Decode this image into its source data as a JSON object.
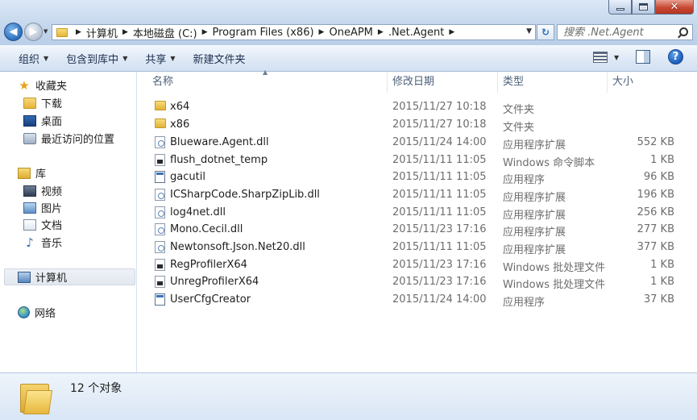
{
  "search": {
    "placeholder": "搜索 .Net.Agent"
  },
  "breadcrumbs": [
    "计算机",
    "本地磁盘 (C:)",
    "Program Files (x86)",
    "OneAPM",
    ".Net.Agent"
  ],
  "toolbar": {
    "organize": "组织",
    "include_in_library": "包含到库中",
    "share": "共享",
    "new_folder": "新建文件夹"
  },
  "nav": {
    "favorites": "收藏夹",
    "downloads": "下载",
    "desktop": "桌面",
    "recent": "最近访问的位置",
    "libraries": "库",
    "videos": "视频",
    "pictures": "图片",
    "documents": "文档",
    "music": "音乐",
    "computer": "计算机",
    "network": "网络"
  },
  "columns": {
    "name": "名称",
    "modified": "修改日期",
    "type": "类型",
    "size": "大小"
  },
  "files": [
    {
      "name": "x64",
      "date": "2015/11/27 10:18",
      "type": "文件夹",
      "size": "",
      "icon": "folder-icon"
    },
    {
      "name": "x86",
      "date": "2015/11/27 10:18",
      "type": "文件夹",
      "size": "",
      "icon": "folder-icon"
    },
    {
      "name": "Blueware.Agent.dll",
      "date": "2015/11/24 14:00",
      "type": "应用程序扩展",
      "size": "552 KB",
      "icon": "dll-icon"
    },
    {
      "name": "flush_dotnet_temp",
      "date": "2015/11/11 11:05",
      "type": "Windows 命令脚本",
      "size": "1 KB",
      "icon": "cmd-script-icon"
    },
    {
      "name": "gacutil",
      "date": "2015/11/11 11:05",
      "type": "应用程序",
      "size": "96 KB",
      "icon": "exe-icon"
    },
    {
      "name": "ICSharpCode.SharpZipLib.dll",
      "date": "2015/11/11 11:05",
      "type": "应用程序扩展",
      "size": "196 KB",
      "icon": "dll-icon"
    },
    {
      "name": "log4net.dll",
      "date": "2015/11/11 11:05",
      "type": "应用程序扩展",
      "size": "256 KB",
      "icon": "dll-icon"
    },
    {
      "name": "Mono.Cecil.dll",
      "date": "2015/11/23 17:16",
      "type": "应用程序扩展",
      "size": "277 KB",
      "icon": "dll-icon"
    },
    {
      "name": "Newtonsoft.Json.Net20.dll",
      "date": "2015/11/11 11:05",
      "type": "应用程序扩展",
      "size": "377 KB",
      "icon": "dll-icon"
    },
    {
      "name": "RegProfilerX64",
      "date": "2015/11/23 17:16",
      "type": "Windows 批处理文件",
      "size": "1 KB",
      "icon": "cmd-script-icon"
    },
    {
      "name": "UnregProfilerX64",
      "date": "2015/11/23 17:16",
      "type": "Windows 批处理文件",
      "size": "1 KB",
      "icon": "cmd-script-icon"
    },
    {
      "name": "UserCfgCreator",
      "date": "2015/11/24 14:00",
      "type": "应用程序",
      "size": "37 KB",
      "icon": "exe-icon"
    }
  ],
  "status": {
    "item_count": "12 个对象"
  }
}
